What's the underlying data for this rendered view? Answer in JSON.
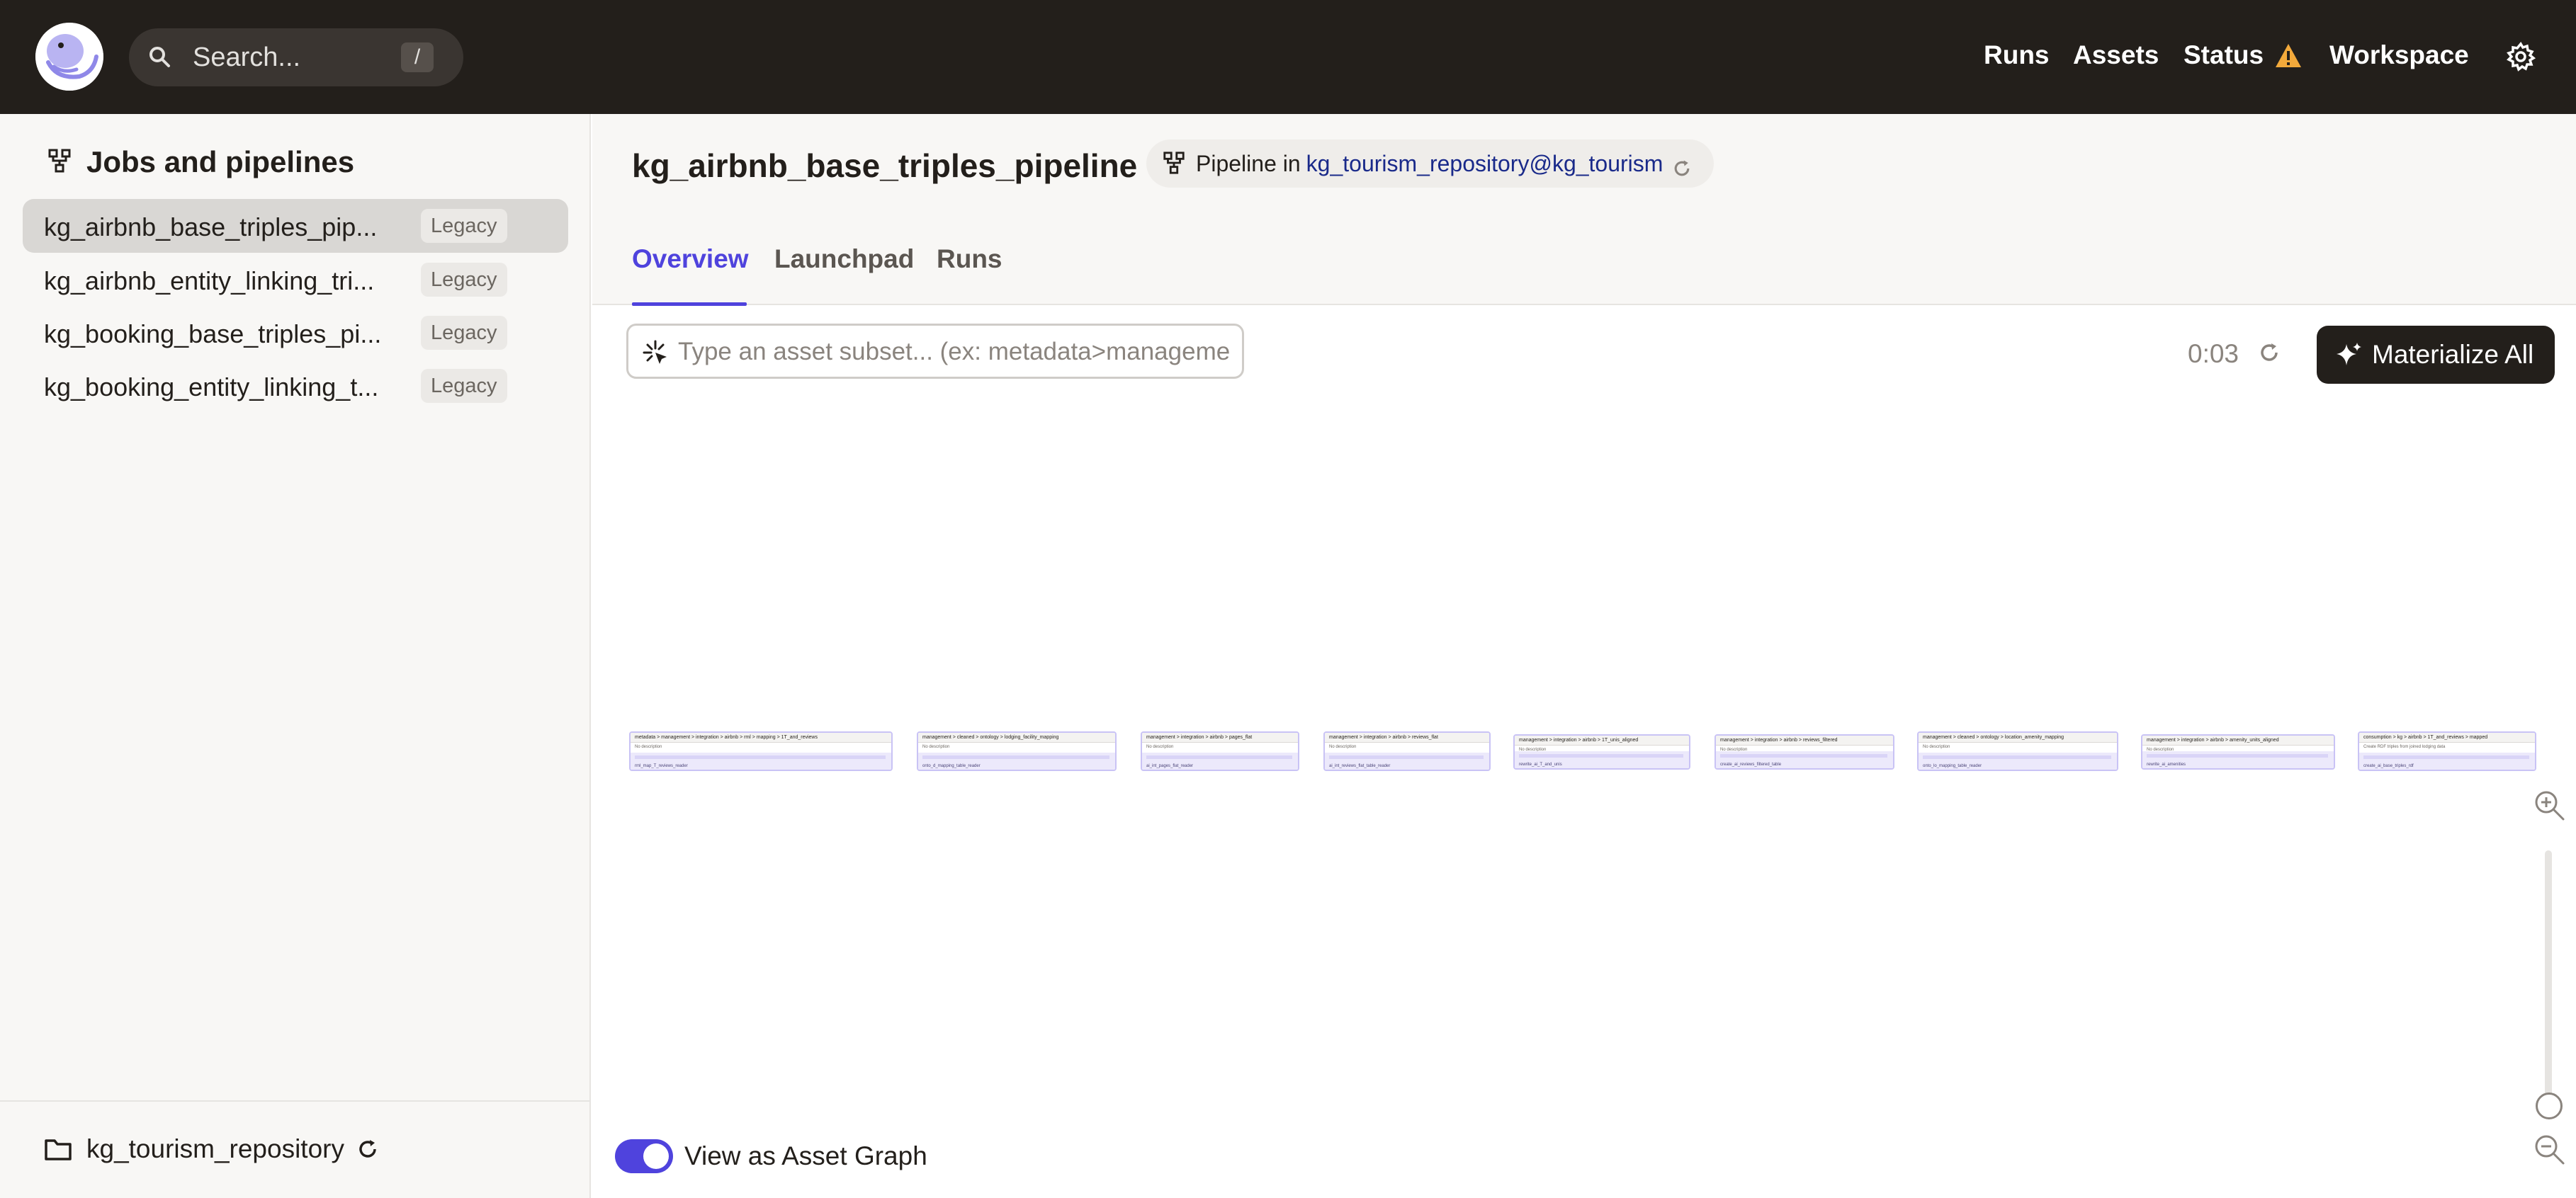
{
  "nav": {
    "search_placeholder": "Search...",
    "search_shortcut": "/",
    "links": [
      "Runs",
      "Assets",
      "Status",
      "Workspace"
    ]
  },
  "sidebar": {
    "title": "Jobs and pipelines",
    "items": [
      {
        "label": "kg_airbnb_base_triples_pip...",
        "badge": "Legacy"
      },
      {
        "label": "kg_airbnb_entity_linking_tri...",
        "badge": "Legacy"
      },
      {
        "label": "kg_booking_base_triples_pi...",
        "badge": "Legacy"
      },
      {
        "label": "kg_booking_entity_linking_t...",
        "badge": "Legacy"
      }
    ],
    "repository": "kg_tourism_repository"
  },
  "header": {
    "title": "kg_airbnb_base_triples_pipeline",
    "chip_label": "Pipeline in",
    "chip_repo": "kg_tourism_repository@kg_tourism",
    "tabs": [
      "Overview",
      "Launchpad",
      "Runs"
    ]
  },
  "toolbar": {
    "filter_placeholder": "Type an asset subset... (ex: metadata>management)",
    "timer": "0:03",
    "materialize_label": "Materialize All"
  },
  "graph": {
    "nodes": [
      {
        "title": "metadata > management > integration > airbnb > rml > mapping > 1T_and_reviews",
        "desc": "No description",
        "op": "rml_map_T_reviews_reader"
      },
      {
        "title": "management > cleaned > ontology > lodging_facility_mapping",
        "desc": "No description",
        "op": "onto_d_mapping_table_reader"
      },
      {
        "title": "management > integration > airbnb > pages_flat",
        "desc": "No description",
        "op": "ai_int_pages_flat_reader"
      },
      {
        "title": "management > integration > airbnb > reviews_flat",
        "desc": "No description",
        "op": "ai_int_reviews_flat_table_reader"
      },
      {
        "title": "management > integration > airbnb > 1T_unis_aligned",
        "desc": "No description",
        "op": "rewrite_ai_T_and_unis"
      },
      {
        "title": "management > integration > airbnb > reviews_filtered",
        "desc": "No description",
        "op": "create_ai_reviews_filtered_table"
      },
      {
        "title": "management > cleaned > ontology > location_amenity_mapping",
        "desc": "No description",
        "op": "onto_lo_mapping_table_reader"
      },
      {
        "title": "management > integration > airbnb > amenity_units_aligned",
        "desc": "No description",
        "op": "rewrite_ai_amenities"
      },
      {
        "title": "consumption > kg > airbnb > 1T_and_reviews > mapped",
        "desc": "Create RDF triples from joined lodging data",
        "op": "create_ai_base_triples_rdf"
      }
    ]
  },
  "footer": {
    "toggle_label": "View as Asset Graph",
    "toggle_on": true
  },
  "colors": {
    "nav_bg": "#231f1b",
    "accent": "#4f43dd",
    "warning": "#f2a93b",
    "sidebar_bg": "#f8f7f5",
    "active_item_bg": "#d9d7d4",
    "link": "#1a2a8a"
  }
}
